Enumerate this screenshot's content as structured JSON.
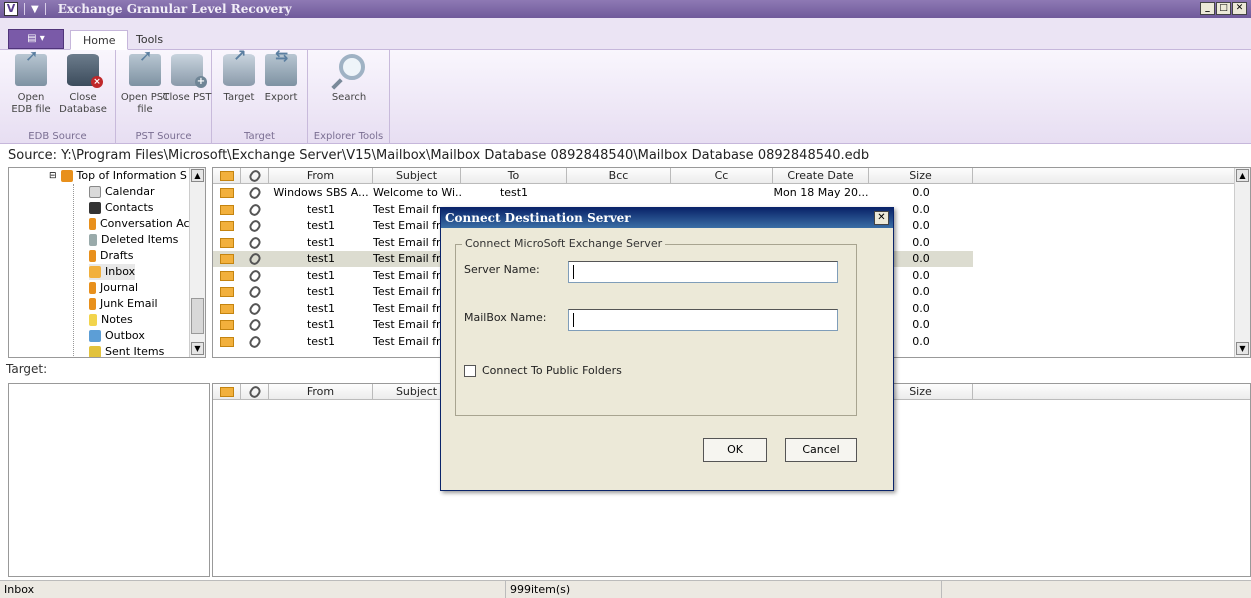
{
  "window": {
    "logo_glyph": "V",
    "quick_access_glyph": "▼",
    "title": "Exchange Granular Level Recovery",
    "min_glyph": "_",
    "max_glyph": "□",
    "close_glyph": "✕"
  },
  "menu": {
    "app_button": "▤ ▾",
    "tabs": [
      "Home",
      "Tools"
    ]
  },
  "ribbon": {
    "groups": [
      {
        "label": "EDB Source",
        "buttons": [
          "Open\nEDB file",
          "Close\nDatabase"
        ]
      },
      {
        "label": "PST Source",
        "buttons": [
          "Open\nPST file",
          "Close\nPST"
        ]
      },
      {
        "label": "Target",
        "buttons": [
          "Target",
          "Export"
        ]
      },
      {
        "label": "Explorer Tools",
        "buttons": [
          "Search"
        ]
      }
    ],
    "open_edb": "Open EDB file",
    "close_db": "Close Database",
    "open_pst": "Open PST file",
    "close_pst": "Close PST",
    "target": "Target",
    "export": "Export",
    "search": "Search"
  },
  "source": {
    "text": "Source: Y:\\Program Files\\Microsoft\\Exchange Server\\V15\\Mailbox\\Mailbox Database 0892848540\\Mailbox Database 0892848540.edb"
  },
  "tree": {
    "root": "Top of Information S",
    "items": [
      "Calendar",
      "Contacts",
      "Conversation Ac",
      "Deleted Items",
      "Drafts",
      "Inbox",
      "Journal",
      "Junk Email",
      "Notes",
      "Outbox",
      "Sent Items"
    ],
    "selected": "Inbox"
  },
  "grid": {
    "columns": [
      "From",
      "Subject",
      "To",
      "Bcc",
      "Cc",
      "Create Date",
      "Size"
    ],
    "rows": [
      {
        "from": "Windows SBS A...",
        "subject": "Welcome to Wi...",
        "to": "test1",
        "date": "Mon 18 May 20...",
        "size": "0.0"
      },
      {
        "from": "test1",
        "subject": "Test Email frc",
        "to": "",
        "date": "",
        "size": "0.0"
      },
      {
        "from": "test1",
        "subject": "Test Email frc",
        "to": "",
        "date": "",
        "size": "0.0"
      },
      {
        "from": "test1",
        "subject": "Test Email frc",
        "to": "",
        "date": "",
        "size": "0.0"
      },
      {
        "from": "test1",
        "subject": "Test Email frc",
        "to": "",
        "date": "",
        "size": "0.0"
      },
      {
        "from": "test1",
        "subject": "Test Email frc",
        "to": "",
        "date": "",
        "size": "0.0"
      },
      {
        "from": "test1",
        "subject": "Test Email frc",
        "to": "",
        "date": "",
        "size": "0.0"
      },
      {
        "from": "test1",
        "subject": "Test Email frc",
        "to": "",
        "date": "",
        "size": "0.0"
      },
      {
        "from": "test1",
        "subject": "Test Email frc",
        "to": "",
        "date": "",
        "size": "0.0"
      },
      {
        "from": "test1",
        "subject": "Test Email frc",
        "to": "",
        "date": "",
        "size": "0.0"
      }
    ],
    "selected_row": 4
  },
  "target": {
    "label": "Target:",
    "columns": [
      "From",
      "Subject",
      "Size"
    ]
  },
  "status": {
    "left": "Inbox",
    "middle": "999item(s)"
  },
  "dialog": {
    "title": "Connect Destination Server",
    "close_glyph": "✕",
    "group_label": "Connect MicroSoft Exchange Server",
    "server_label": "Server Name:",
    "server_value": "",
    "mailbox_label": "MailBox Name:",
    "mailbox_value": "",
    "public_folders_label": "Connect To Public Folders",
    "ok": "OK",
    "cancel": "Cancel"
  },
  "colors": {
    "title_bar": "#7a63a6",
    "ribbon_bg": "#efe8f7",
    "dialog_title": "#0a246a",
    "envelope": "#f2b03c"
  }
}
